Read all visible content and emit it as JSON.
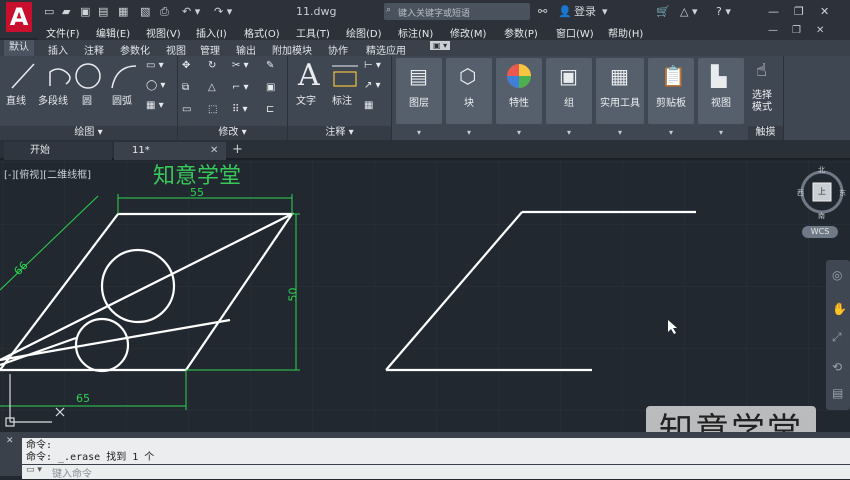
{
  "app": {
    "logo_letter": "A",
    "file_title": "11.dwg"
  },
  "search": {
    "placeholder": "键入关键字或短语"
  },
  "account": {
    "login": "登录"
  },
  "menubar": [
    "文件(F)",
    "编辑(E)",
    "视图(V)",
    "插入(I)",
    "格式(O)",
    "工具(T)",
    "绘图(D)",
    "标注(N)",
    "修改(M)",
    "参数(P)",
    "窗口(W)",
    "帮助(H)"
  ],
  "ribbon_tabs": [
    "默认",
    "插入",
    "注释",
    "参数化",
    "视图",
    "管理",
    "输出",
    "附加模块",
    "协作",
    "精选应用"
  ],
  "panels": {
    "draw": {
      "title": "绘图 ▾",
      "tools": [
        "直线",
        "多段线",
        "圆",
        "圆弧"
      ]
    },
    "modify": {
      "title": "修改 ▾"
    },
    "annotation": {
      "title": "注释 ▾",
      "tools": [
        "文字",
        "标注"
      ]
    },
    "big_tools": [
      "图层",
      "块",
      "特性",
      "组",
      "实用工具",
      "剪贴板",
      "视图"
    ],
    "touch": {
      "label": "选择模式",
      "title": "触摸"
    }
  },
  "doc_tabs": {
    "start": "开始",
    "current": "11*",
    "add": "+"
  },
  "viewport": {
    "label": "[-][俯视][二维线框]",
    "brand": "知意学堂"
  },
  "dimensions": {
    "top": "55",
    "bottom": "65",
    "right": "50",
    "slant": "66"
  },
  "viewcube": {
    "north": "北",
    "south": "南",
    "west": "西",
    "east": "东",
    "face": "上",
    "wcs": "WCS"
  },
  "watermark": "知意学堂",
  "command": {
    "line1": "命令:",
    "line2": "命令: _.erase 找到 1 个",
    "input_placeholder": "键入命令"
  }
}
